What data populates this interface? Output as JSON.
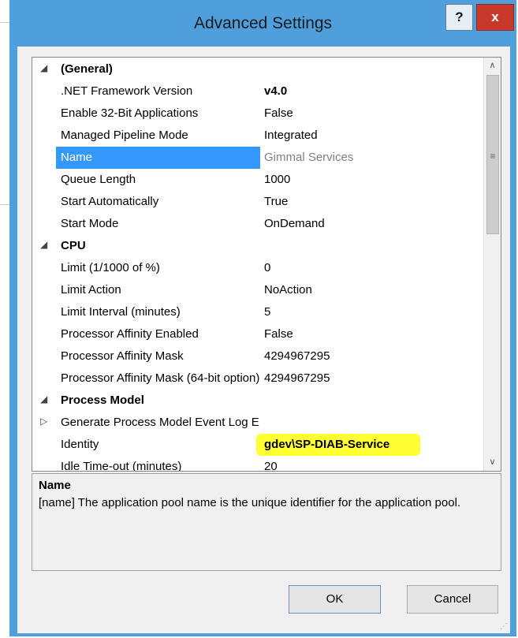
{
  "window": {
    "title": "Advanced Settings",
    "help_label": "?",
    "close_label": "x"
  },
  "grid": {
    "rows": [
      {
        "type": "category",
        "expander": "◢",
        "name": "(General)"
      },
      {
        "type": "property",
        "name": ".NET Framework Version",
        "value": "v4.0",
        "bold": true
      },
      {
        "type": "property",
        "name": "Enable 32-Bit Applications",
        "value": "False"
      },
      {
        "type": "property",
        "name": "Managed Pipeline Mode",
        "value": "Integrated"
      },
      {
        "type": "property",
        "name": "Name",
        "value": "Gimmal Services",
        "selected": true
      },
      {
        "type": "property",
        "name": "Queue Length",
        "value": "1000"
      },
      {
        "type": "property",
        "name": "Start Automatically",
        "value": "True"
      },
      {
        "type": "property",
        "name": "Start Mode",
        "value": "OnDemand"
      },
      {
        "type": "category",
        "expander": "◢",
        "name": "CPU"
      },
      {
        "type": "property",
        "name": "Limit (1/1000 of %)",
        "value": "0"
      },
      {
        "type": "property",
        "name": "Limit Action",
        "value": "NoAction"
      },
      {
        "type": "property",
        "name": "Limit Interval (minutes)",
        "value": "5"
      },
      {
        "type": "property",
        "name": "Processor Affinity Enabled",
        "value": "False"
      },
      {
        "type": "property",
        "name": "Processor Affinity Mask",
        "value": "4294967295"
      },
      {
        "type": "property",
        "name": "Processor Affinity Mask (64-bit option)",
        "value": "4294967295"
      },
      {
        "type": "category",
        "expander": "◢",
        "name": "Process Model"
      },
      {
        "type": "property",
        "expander": "▷",
        "name": "Generate Process Model Event Log Entry",
        "value": ""
      },
      {
        "type": "property",
        "name": "Identity",
        "value": "gdev\\SP-DIAB-Service",
        "bold": true,
        "highlight": true
      },
      {
        "type": "property",
        "name": "Idle Time-out (minutes)",
        "value": "20"
      }
    ],
    "scroll_up": "∧",
    "scroll_down": "∨",
    "scroll_grip": "≡"
  },
  "description": {
    "title": "Name",
    "text": "[name] The application pool name is the unique identifier for the application pool."
  },
  "buttons": {
    "ok": "OK",
    "cancel": "Cancel"
  },
  "colors": {
    "selection": "#3399ff",
    "highlight": "#ffff33",
    "frame": "#4f9fdc",
    "close": "#c8392b"
  }
}
